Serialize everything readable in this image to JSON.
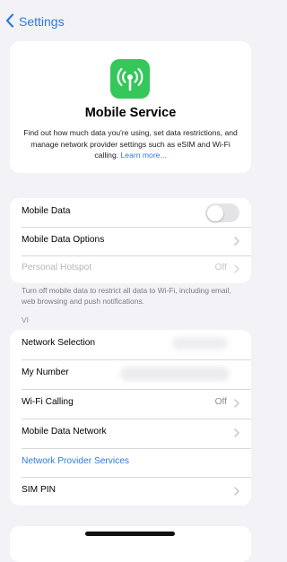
{
  "nav": {
    "back_label": "Settings"
  },
  "hero": {
    "icon": "antenna-icon",
    "title": "Mobile Service",
    "description": "Find out how much data you're using, set data restrictions, and manage network provider settings such as eSIM and Wi-Fi calling.",
    "link": "Learn more..."
  },
  "data_group": {
    "rows": [
      {
        "label": "Mobile Data",
        "toggle_on": false
      },
      {
        "label": "Mobile Data Options"
      },
      {
        "label": "Personal Hotspot",
        "value": "Off",
        "disabled": true
      }
    ],
    "footnote": "Turn off mobile data to restrict all data to Wi-Fi, including email, web browsing and push notifications."
  },
  "carrier_group": {
    "header": "VI",
    "rows": [
      {
        "label": "Network Selection"
      },
      {
        "label": "My Number"
      },
      {
        "label": "Wi-Fi Calling",
        "value": "Off"
      },
      {
        "label": "Mobile Data Network"
      },
      {
        "label": "Network Provider Services"
      },
      {
        "label": "SIM PIN"
      }
    ]
  },
  "colors": {
    "accent": "#2f7ad9",
    "icon_green": "#34c759",
    "background": "#f2f2f7"
  }
}
